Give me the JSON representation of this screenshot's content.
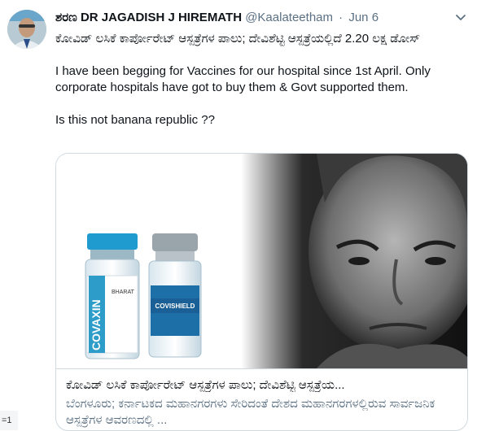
{
  "tweet": {
    "author_name": "ಶರಣ DR JAGADISH J HIREMATH",
    "handle": "@Kaalateetham",
    "separator": "·",
    "date": "Jun 6",
    "body": {
      "line1": "ಕೋವಿಡ್ ಲಸಿಕೆ ಕಾರ್ಪೋರೇಟ್ ಆಸ್ಪತ್ರೆಗಳ ಪಾಲು; ದೇವಿಶೆಟ್ಟಿ ಆಸ್ಪತ್ರೆಯಲ್ಲಿದೆ 2.20 ಲಕ್ಷ ಡೋಸ್",
      "line2": "I have been begging for Vaccines for our hospital since 1st April. Only corporate hospitals have got to buy them & Govt supported them.",
      "line3": "Is this not banana republic ??"
    },
    "card": {
      "title": "ಕೋವಿಡ್ ಲಸಿಕೆ ಕಾರ್ಪೋರೇಟ್ ಆಸ್ಪತ್ರೆಗಳ ಪಾಲು; ದೇವಿಶೆಟ್ಟಿ ಆಸ್ಪತ್ರೆಯ...",
      "description": "ಬೆಂಗಳೂರು; ಕರ್ನಾಟಕದ ಮಹಾನಗರಗಳು ಸೇರಿದಂತೆ ದೇಶದ ಮಹಾನಗರಗಳಲ್ಲಿರುವ ಸಾರ್ವಜನಿಕ ಆಸ್ಪತ್ರೆಗಳ ಆವರಣದಲ್ಲಿ ...",
      "vial_left_label": "COVAXIN",
      "vial_left_brand": "BHARAT",
      "vial_right_label": "COVISHIELD"
    }
  },
  "left_stub_text": "=1",
  "icons": {
    "caret": "chevron-down-icon"
  }
}
